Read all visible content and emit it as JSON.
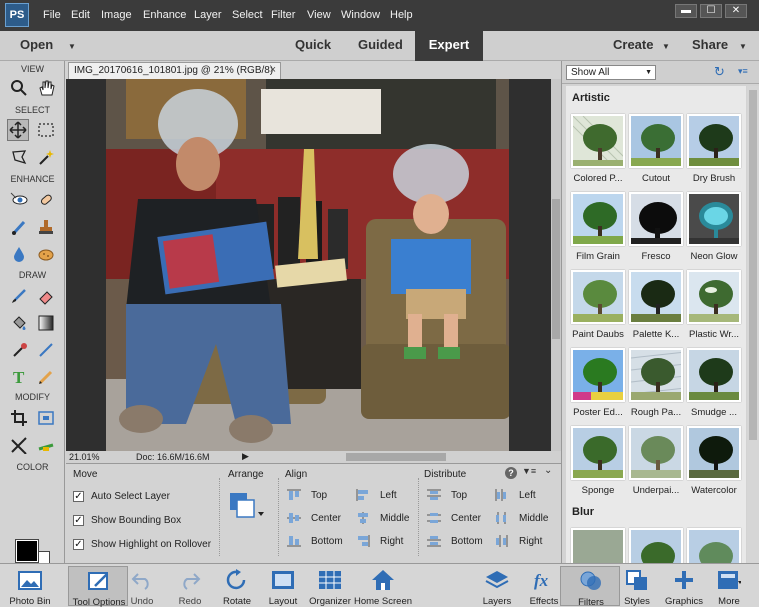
{
  "app": {
    "logo_text": "PS"
  },
  "menu": [
    "File",
    "Edit",
    "Image",
    "Enhance",
    "Layer",
    "Select",
    "Filter",
    "View",
    "Window",
    "Help"
  ],
  "window_controls": [
    "▬",
    "☐",
    "✕"
  ],
  "modes": {
    "open": "Open",
    "quick": "Quick",
    "guided": "Guided",
    "expert": "Expert",
    "create": "Create",
    "share": "Share"
  },
  "toolbox": {
    "view": "VIEW",
    "select": "SELECT",
    "enhance": "ENHANCE",
    "draw": "DRAW",
    "modify": "MODIFY",
    "color": "COLOR"
  },
  "document": {
    "tab_title": "IMG_20170616_101801.jpg @ 21% (RGB/8)",
    "close_glyph": "×",
    "zoom": "21.01%",
    "doc_size": "Doc: 16.6M/16.6M"
  },
  "tool_options": {
    "move_title": "Move",
    "auto_select": "Auto Select Layer",
    "bounding_box": "Show Bounding Box",
    "highlight": "Show Highlight on Rollover",
    "arrange_title": "Arrange",
    "align_title": "Align",
    "align": {
      "top": "Top",
      "center": "Center",
      "bottom": "Bottom",
      "left": "Left",
      "middle": "Middle",
      "right": "Right"
    },
    "distribute_title": "Distribute",
    "distribute": {
      "top": "Top",
      "center": "Center",
      "bottom": "Bottom",
      "left": "Left",
      "middle": "Middle",
      "right": "Right"
    },
    "help_glyph": "?"
  },
  "panel": {
    "show_all": "Show All",
    "categories": [
      {
        "name": "Artistic",
        "filters": [
          "Colored P...",
          "Cutout",
          "Dry Brush",
          "Film Grain",
          "Fresco",
          "Neon Glow",
          "Paint Daubs",
          "Palette K...",
          "Plastic Wr...",
          "Poster Ed...",
          "Rough Pa...",
          "Smudge ...",
          "Sponge",
          "Underpai...",
          "Watercolor"
        ]
      },
      {
        "name": "Blur",
        "filters": []
      }
    ]
  },
  "taskbar": {
    "photo_bin": "Photo Bin",
    "tool_options": "Tool Options",
    "undo": "Undo",
    "redo": "Redo",
    "rotate": "Rotate",
    "layout": "Layout",
    "organizer": "Organizer",
    "home_screen": "Home Screen",
    "layers": "Layers",
    "effects": "Effects",
    "filters": "Filters",
    "styles": "Styles",
    "graphics": "Graphics",
    "more": "More"
  },
  "colors": {
    "menubar": "#3b3b3b",
    "accent_blue": "#2f6db5",
    "icon_blue": "#3a78c2"
  }
}
